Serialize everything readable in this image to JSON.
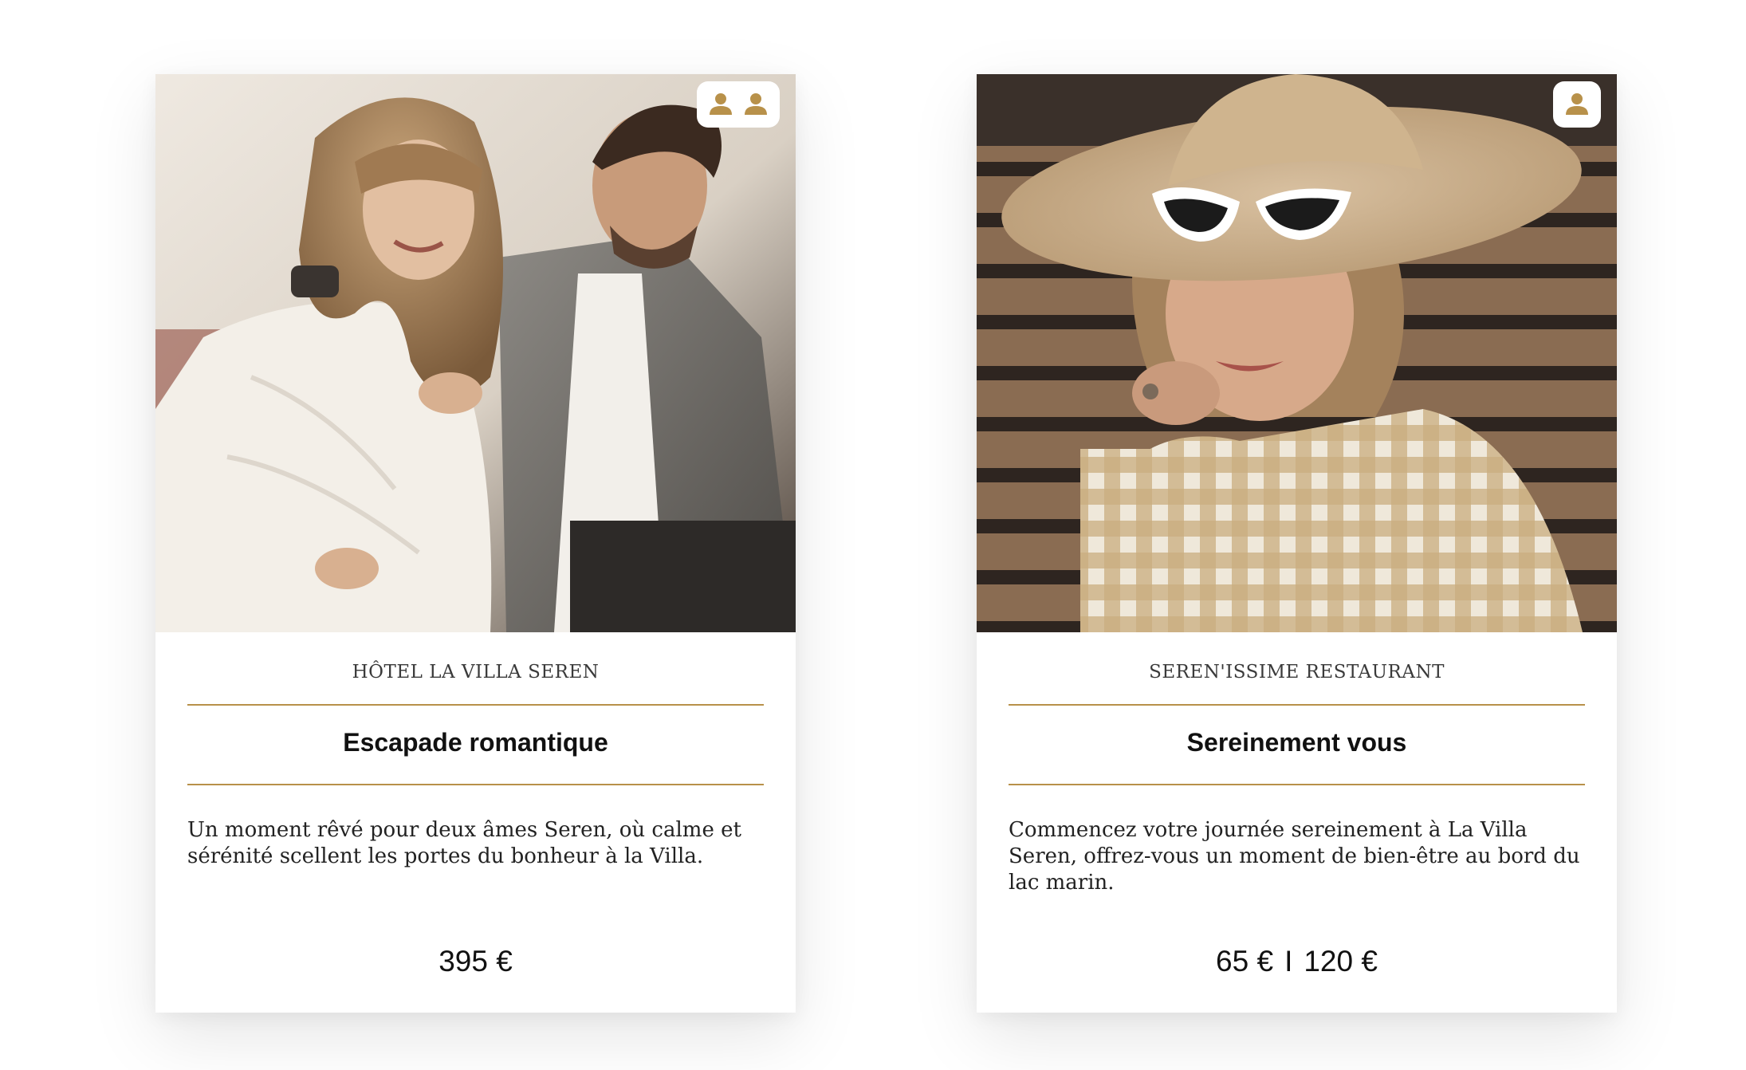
{
  "colors": {
    "accent": "#b8914a",
    "text": "#111111"
  },
  "cards": [
    {
      "venue": "HÔTEL LA VILLA SEREN",
      "title": "Escapade romantique",
      "description": "Un moment rêvé pour deux âmes Seren, où calme et sérénité scellent les portes du bonheur à la Villa.",
      "guest_icons": [
        "person-icon",
        "person-icon"
      ],
      "prices": [
        "395 €"
      ]
    },
    {
      "venue": "SEREN'ISSIME RESTAURANT",
      "title": "Sereinement vous",
      "description": "Commencez votre journée sereinement à La Villa Seren, offrez-vous un moment de bien-être au bord du lac marin.",
      "guest_icons": [
        "person-icon"
      ],
      "prices": [
        "65 €",
        "120 €"
      ],
      "price_separator": "I"
    }
  ]
}
